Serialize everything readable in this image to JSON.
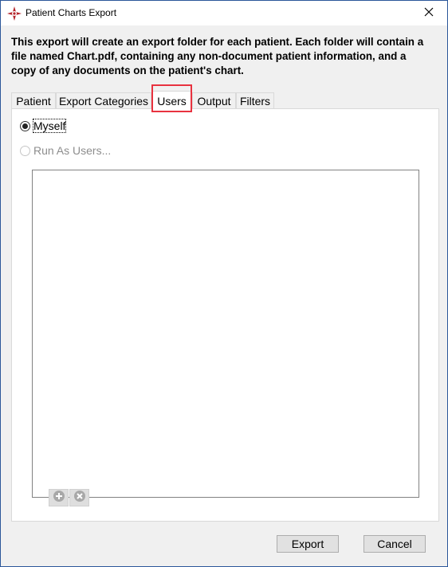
{
  "window": {
    "title": "Patient Charts Export",
    "close_symbol": "✕"
  },
  "description": "This export will create an export folder for each patient. Each folder will contain a file named Chart.pdf, containing any non-document patient information, and a copy of any documents on the patient's chart.",
  "tabs": [
    {
      "label": "Patient",
      "active": false
    },
    {
      "label": "Export Categories",
      "active": false
    },
    {
      "label": "Users",
      "active": true
    },
    {
      "label": "Output",
      "active": false
    },
    {
      "label": "Filters",
      "active": false
    }
  ],
  "users_tab": {
    "options": [
      {
        "label": "Myself",
        "checked": true,
        "enabled": true
      },
      {
        "label": "Run As Users...",
        "checked": false,
        "enabled": false
      }
    ],
    "user_list": [],
    "list_buttons": {
      "add_icon": "plus-circle-icon",
      "remove_icon": "x-circle-icon"
    }
  },
  "buttons": {
    "export": "Export",
    "cancel": "Cancel"
  },
  "colors": {
    "highlight_box": "#e8323f",
    "disabled_text": "#8d8d8d"
  }
}
